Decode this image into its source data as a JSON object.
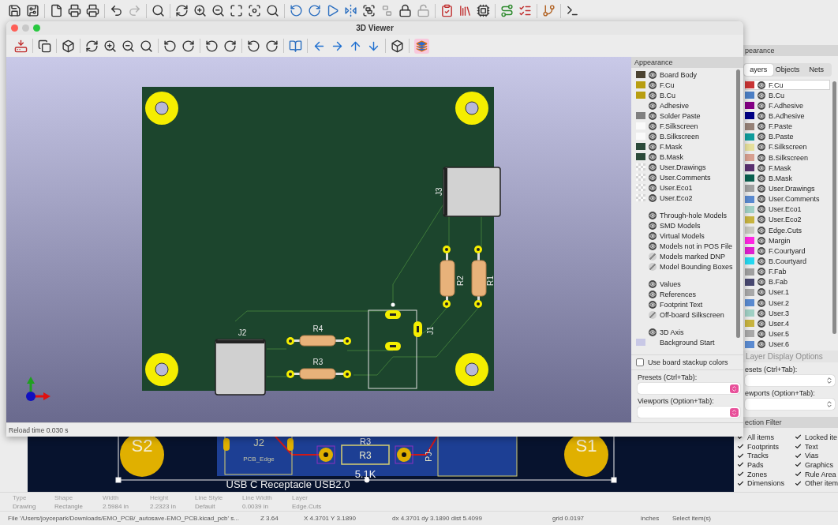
{
  "viewer": {
    "title": "3D Viewer",
    "appearance_toggle_on": true,
    "reference_labels": [
      "J3",
      "R2",
      "R1",
      "J1",
      "R4",
      "R3",
      "J2"
    ],
    "appearance": {
      "title": "Appearance",
      "groups": [
        [
          {
            "label": "Board Body",
            "kind": "solid",
            "color": "#4a4230",
            "visible": true
          },
          {
            "label": "F.Cu",
            "kind": "solid",
            "color": "#b89e10",
            "visible": true
          },
          {
            "label": "B.Cu",
            "kind": "solid",
            "color": "#b89e10",
            "visible": true
          },
          {
            "label": "Adhesive",
            "kind": "none",
            "visible": true
          },
          {
            "label": "Solder Paste",
            "kind": "solid",
            "color": "#808080",
            "visible": true
          },
          {
            "label": "F.Silkscreen",
            "kind": "solid",
            "color": "#fafafa",
            "visible": true
          },
          {
            "label": "B.Silkscreen",
            "kind": "solid",
            "color": "#fafafa",
            "visible": true
          },
          {
            "label": "F.Mask",
            "kind": "solid",
            "color": "#2b4a3a",
            "visible": true
          },
          {
            "label": "B.Mask",
            "kind": "solid",
            "color": "#2b4a3a",
            "visible": true
          },
          {
            "label": "User.Drawings",
            "kind": "checker",
            "visible": true
          },
          {
            "label": "User.Comments",
            "kind": "checker",
            "visible": true
          },
          {
            "label": "User.Eco1",
            "kind": "checker",
            "visible": true
          },
          {
            "label": "User.Eco2",
            "kind": "checker",
            "visible": true
          }
        ],
        [
          {
            "label": "Through-hole Models",
            "kind": "none",
            "visible": true
          },
          {
            "label": "SMD Models",
            "kind": "none",
            "visible": true
          },
          {
            "label": "Virtual Models",
            "kind": "none",
            "visible": true
          },
          {
            "label": "Models not in POS File",
            "kind": "none",
            "visible": true
          },
          {
            "label": "Models marked DNP",
            "kind": "none",
            "visible": false
          },
          {
            "label": "Model Bounding Boxes",
            "kind": "none",
            "visible": false
          }
        ],
        [
          {
            "label": "Values",
            "kind": "none",
            "visible": true
          },
          {
            "label": "References",
            "kind": "none",
            "visible": true
          },
          {
            "label": "Footprint Text",
            "kind": "none",
            "visible": true
          },
          {
            "label": "Off-board Silkscreen",
            "kind": "none",
            "visible": false
          }
        ],
        [
          {
            "label": "3D Axis",
            "kind": "none",
            "visible": true
          },
          {
            "label": "Background Start",
            "kind": "solid",
            "color": "#c8c8e6"
          }
        ]
      ],
      "stackup": {
        "label": "Use board stackup colors",
        "checked": false
      },
      "presets_label": "Presets (Ctrl+Tab):",
      "viewports_label": "Viewports (Option+Tab):"
    },
    "status": "Reload time 0.030 s"
  },
  "board_canvas": {
    "pad_labels": [
      "S2",
      "S1"
    ],
    "connector_label": "J2",
    "edge_label": "PCB_Edge",
    "resistor_labels": [
      "R3",
      "R3"
    ],
    "value": "5.1K",
    "side_label": "PJ-",
    "caption": "USB C Receptacle USB2.0"
  },
  "appearance_panel": {
    "title": "pearance",
    "tabs": [
      {
        "label": "ayers",
        "selected": true
      },
      {
        "label": "Objects",
        "selected": false
      },
      {
        "label": "Nets",
        "selected": false
      }
    ],
    "layers": [
      {
        "label": "F.Cu",
        "color": "#c83434",
        "selected": true
      },
      {
        "label": "B.Cu",
        "color": "#4d7fc4",
        "selected": false
      },
      {
        "label": "F.Adhesive",
        "color": "#840084",
        "selected": false
      },
      {
        "label": "B.Adhesive",
        "color": "#000084",
        "selected": false
      },
      {
        "label": "F.Paste",
        "color": "#968278",
        "selected": false
      },
      {
        "label": "B.Paste",
        "color": "#0f9c9c",
        "selected": false
      },
      {
        "label": "F.Silkscreen",
        "color": "#e6e09c",
        "selected": false
      },
      {
        "label": "B.Silkscreen",
        "color": "#d8a090",
        "selected": false
      },
      {
        "label": "F.Mask",
        "color": "#5a3070",
        "selected": false
      },
      {
        "label": "B.Mask",
        "color": "#0a6050",
        "selected": false
      },
      {
        "label": "User.Drawings",
        "color": "#a0a0a0",
        "selected": false
      },
      {
        "label": "User.Comments",
        "color": "#5a8ad0",
        "selected": false
      },
      {
        "label": "User.Eco1",
        "color": "#a0d0c4",
        "selected": false
      },
      {
        "label": "User.Eco2",
        "color": "#c8b440",
        "selected": false
      },
      {
        "label": "Edge.Cuts",
        "color": "#c8c8c0",
        "selected": false
      },
      {
        "label": "Margin",
        "color": "#ff26e2",
        "selected": false
      },
      {
        "label": "F.Courtyard",
        "color": "#e020d0",
        "selected": false
      },
      {
        "label": "B.Courtyard",
        "color": "#26d8f0",
        "selected": false
      },
      {
        "label": "F.Fab",
        "color": "#a0a0a0",
        "selected": false
      },
      {
        "label": "B.Fab",
        "color": "#484870",
        "selected": false
      },
      {
        "label": "User.1",
        "color": "#a8a8a8",
        "selected": false
      },
      {
        "label": "User.2",
        "color": "#5a8ad0",
        "selected": false
      },
      {
        "label": "User.3",
        "color": "#a0d0c4",
        "selected": false
      },
      {
        "label": "User.4",
        "color": "#c8b440",
        "selected": false
      },
      {
        "label": "User.5",
        "color": "#a9a9a9",
        "selected": false
      },
      {
        "label": "User.6",
        "color": "#5b8bd1",
        "selected": false
      }
    ],
    "display_options": "Layer Display Options",
    "presets_label": "esets (Ctrl+Tab):",
    "viewports_label": "ewports (Option+Tab):"
  },
  "selection_filter": {
    "title": "ection Filter",
    "items": [
      {
        "label": "All items",
        "checked": true
      },
      {
        "label": "Locked ite",
        "checked": true
      },
      {
        "label": "Footprints",
        "checked": true
      },
      {
        "label": "Text",
        "checked": true
      },
      {
        "label": "Tracks",
        "checked": true
      },
      {
        "label": "Vias",
        "checked": true
      },
      {
        "label": "Pads",
        "checked": true
      },
      {
        "label": "Graphics",
        "checked": true
      },
      {
        "label": "Zones",
        "checked": true
      },
      {
        "label": "Rule Area",
        "checked": true
      },
      {
        "label": "Dimensions",
        "checked": true
      },
      {
        "label": "Other item",
        "checked": true
      }
    ]
  },
  "message_panel": [
    {
      "label": "Type",
      "value": "Drawing"
    },
    {
      "label": "Shape",
      "value": "Rectangle"
    },
    {
      "label": "Width",
      "value": "2.5984 in"
    },
    {
      "label": "Height",
      "value": "2.2323 in"
    },
    {
      "label": "Line Style",
      "value": "Default"
    },
    {
      "label": "Line Width",
      "value": "0.0039 in"
    },
    {
      "label": "Layer",
      "value": "Edge.Cuts"
    }
  ],
  "status_bar": [
    "File '/Users/joycepark/Downloads/EMO_PCB/_autosave-EMO_PCB.kicad_pcb' s...",
    "Z 3.64",
    "X 4.3701  Y 3.1890",
    "dx 4.3701  dy 3.1890  dist 5.4099",
    "grid 0.0197",
    "inches",
    "Select item(s)"
  ]
}
